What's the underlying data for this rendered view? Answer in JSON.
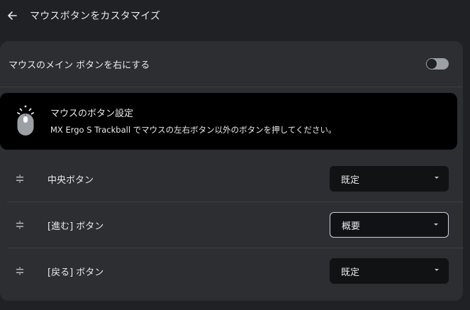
{
  "header": {
    "title": "マウスボタンをカスタマイズ",
    "back_icon": "arrow-left-icon"
  },
  "primary_button_setting": {
    "label": "マウスのメイン ボタンを右にする",
    "toggle_on": false
  },
  "banner": {
    "icon": "mouse-icon",
    "title": "マウスのボタン設定",
    "description": "MX Ergo S Trackball でマウスの左右ボタン以外のボタンを押してください。"
  },
  "buttons": [
    {
      "label": "中央ボタン",
      "value": "既定",
      "focused": false
    },
    {
      "label": "[進む] ボタン",
      "value": "概要",
      "focused": true
    },
    {
      "label": "[戻る] ボタン",
      "value": "既定",
      "focused": false
    }
  ],
  "colors": {
    "background": "#202124",
    "card": "#2d2e31",
    "banner": "#000000",
    "select": "#111213",
    "focus_ring": "#c6cfea",
    "text": "#e8eaed"
  }
}
